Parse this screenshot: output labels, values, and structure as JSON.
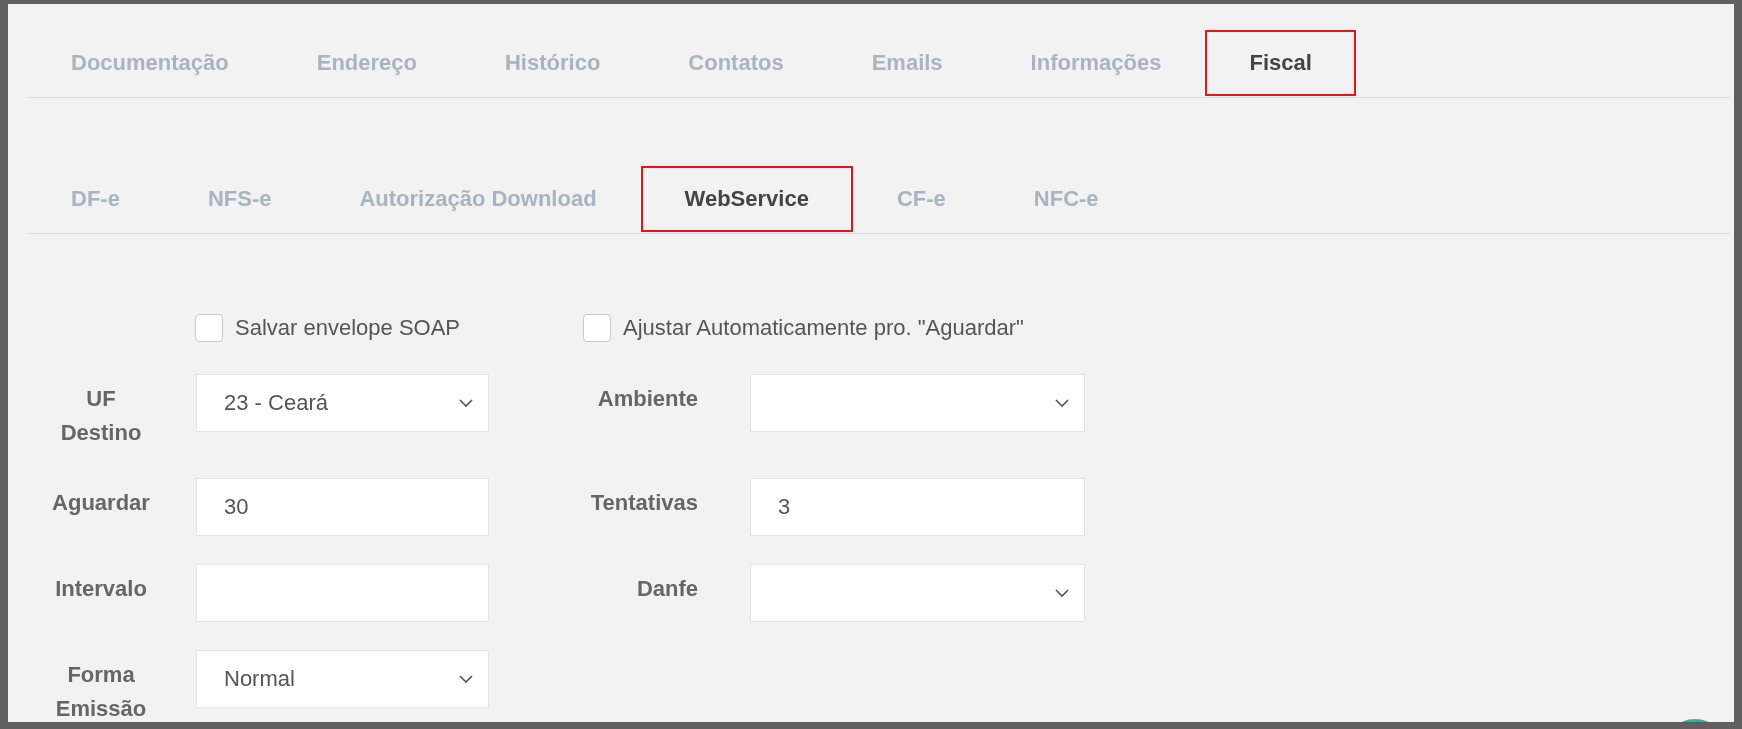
{
  "tabs": [
    {
      "label": "Documentação",
      "selected": false
    },
    {
      "label": "Endereço",
      "selected": false
    },
    {
      "label": "Histórico",
      "selected": false
    },
    {
      "label": "Contatos",
      "selected": false
    },
    {
      "label": "Emails",
      "selected": false
    },
    {
      "label": "Informações",
      "selected": false
    },
    {
      "label": "Fiscal",
      "selected": true
    }
  ],
  "subtabs": [
    {
      "label": "DF-e",
      "selected": false
    },
    {
      "label": "NFS-e",
      "selected": false
    },
    {
      "label": "Autorização Download",
      "selected": false
    },
    {
      "label": "WebService",
      "selected": true
    },
    {
      "label": "CF-e",
      "selected": false
    },
    {
      "label": "NFC-e",
      "selected": false
    }
  ],
  "checkboxes": [
    {
      "label": "Salvar envelope SOAP",
      "checked": false
    },
    {
      "label": "Ajustar Automaticamente pro. \"Aguardar\"",
      "checked": false
    }
  ],
  "form_rows": [
    [
      {
        "label": "UF Destino",
        "kind": "select",
        "value": "23 - Ceará"
      },
      {
        "label": "Ambiente",
        "kind": "select"
      }
    ],
    [
      {
        "label": "Aguardar",
        "kind": "text",
        "value": "30"
      },
      {
        "label": "Tentativas",
        "kind": "text",
        "value": "3"
      }
    ],
    [
      {
        "label": "Intervalo",
        "kind": "text"
      },
      {
        "label": "Danfe",
        "kind": "select"
      }
    ],
    [
      {
        "label": "Forma Emissão",
        "kind": "select",
        "value": "Normal"
      }
    ]
  ]
}
